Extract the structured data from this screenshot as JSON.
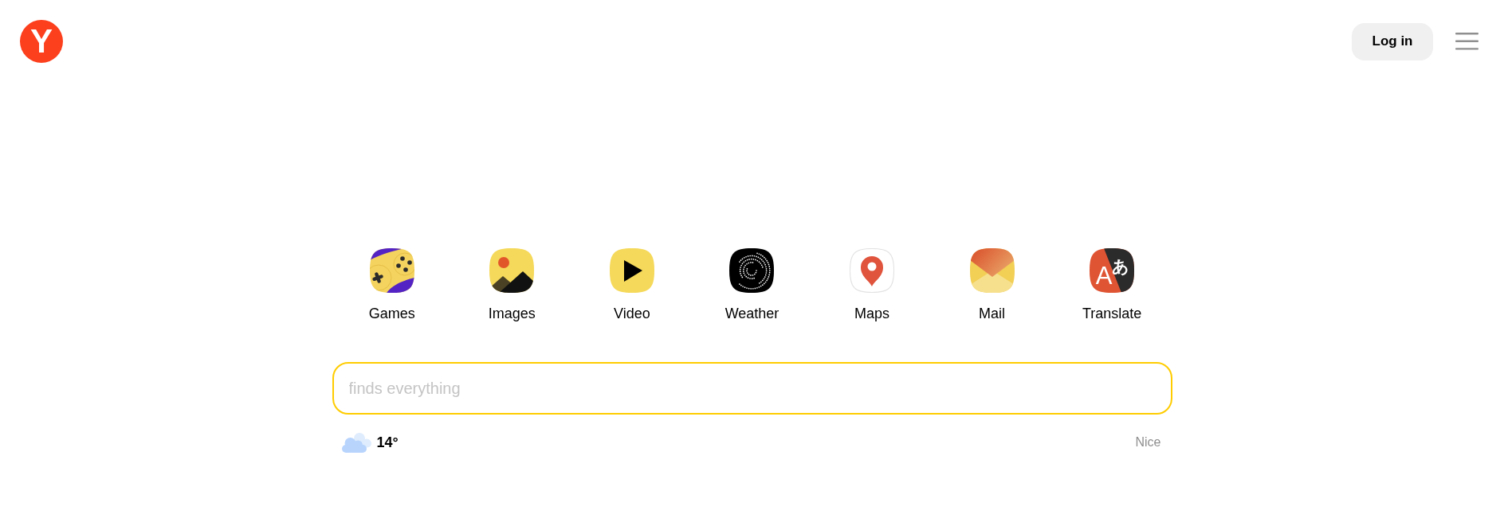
{
  "header": {
    "logo": {
      "text": "Y"
    },
    "login_button": {
      "label": "Log in"
    }
  },
  "services": [
    {
      "kind": "games",
      "label": "Games"
    },
    {
      "kind": "images",
      "label": "Images"
    },
    {
      "kind": "video",
      "label": "Video"
    },
    {
      "kind": "weather",
      "label": "Weather"
    },
    {
      "kind": "maps",
      "label": "Maps"
    },
    {
      "kind": "mail",
      "label": "Mail"
    },
    {
      "kind": "translate",
      "label": "Translate",
      "glyphs": [
        "A",
        "あ"
      ]
    }
  ],
  "search": {
    "placeholder": "finds everything"
  },
  "weather": {
    "temperature": "14°",
    "location": "Nice"
  }
}
